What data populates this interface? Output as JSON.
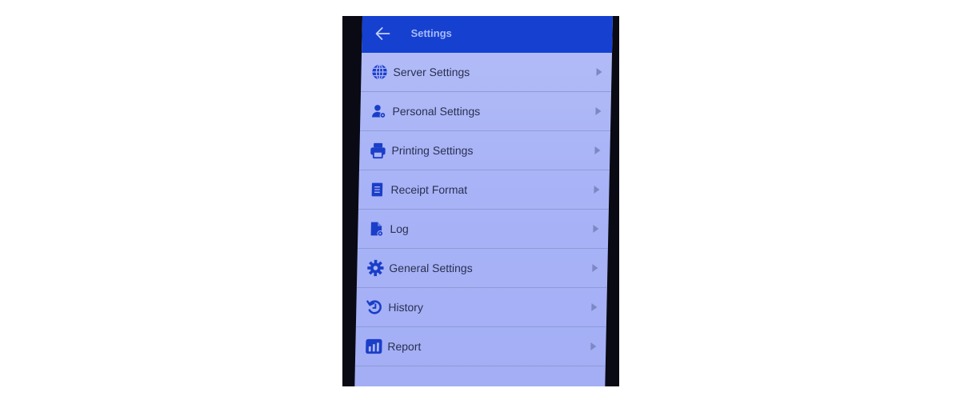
{
  "header": {
    "title": "Settings",
    "back_icon": "arrow-left-icon"
  },
  "colors": {
    "appbar": "#1540d0",
    "icon": "#1a3ec8",
    "list_bg": "#abb5f6",
    "text": "#2a3050"
  },
  "menu": {
    "items": [
      {
        "label": "Server Settings",
        "icon": "globe-icon"
      },
      {
        "label": "Personal Settings",
        "icon": "user-gear-icon"
      },
      {
        "label": "Printing Settings",
        "icon": "printer-icon"
      },
      {
        "label": "Receipt Format",
        "icon": "receipt-icon"
      },
      {
        "label": "Log",
        "icon": "file-gear-icon"
      },
      {
        "label": "General Settings",
        "icon": "gear-icon"
      },
      {
        "label": "History",
        "icon": "history-icon"
      },
      {
        "label": "Report",
        "icon": "bar-chart-icon"
      }
    ]
  }
}
